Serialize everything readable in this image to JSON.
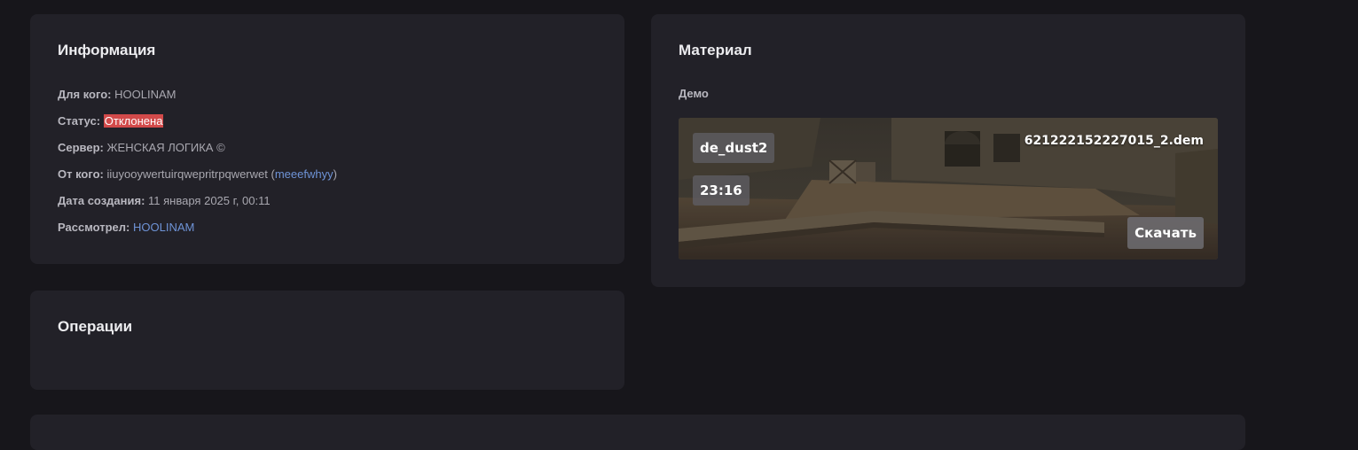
{
  "info": {
    "title": "Информация",
    "for_whom": {
      "label": "Для кого:",
      "value": "HOOLINAM"
    },
    "status": {
      "label": "Статус:",
      "value": "Отклонена"
    },
    "server": {
      "label": "Сервер:",
      "value": "ЖЕНСКАЯ ЛОГИКА ©"
    },
    "from": {
      "label": "От кого:",
      "value": "iiuyooywertuirqwepritrpqwerwet",
      "open_paren": "(",
      "link": "meeefwhyy",
      "close_paren": ")"
    },
    "created": {
      "label": "Дата создания:",
      "value": "11 января 2025 г, 00:11"
    },
    "reviewed": {
      "label": "Рассмотрел:",
      "value": "HOOLINAM"
    }
  },
  "operations": {
    "title": "Операции"
  },
  "material": {
    "title": "Материал",
    "section_label": "Демо",
    "demo": {
      "map": "de_dust2",
      "duration": "23:16",
      "filename": "621222152227015_2.dem",
      "download_label": "Скачать"
    }
  },
  "colors": {
    "page_bg": "#17161b",
    "card_bg": "#222128",
    "status_declined": "#d24a4a",
    "link": "#6e93d6"
  }
}
